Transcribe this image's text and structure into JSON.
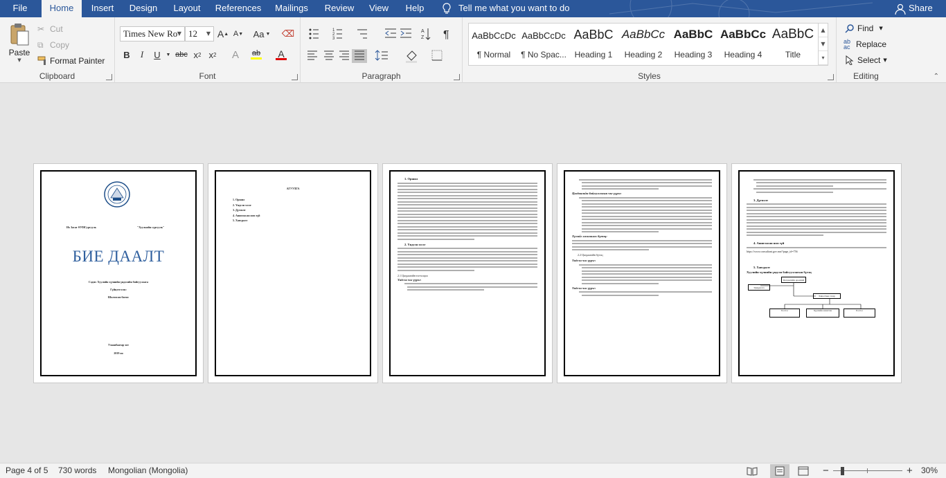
{
  "tabs": [
    {
      "label": "File",
      "active": false
    },
    {
      "label": "Home",
      "active": true
    },
    {
      "label": "Insert",
      "active": false
    },
    {
      "label": "Design",
      "active": false
    },
    {
      "label": "Layout",
      "active": false
    },
    {
      "label": "References",
      "active": false
    },
    {
      "label": "Mailings",
      "active": false
    },
    {
      "label": "Review",
      "active": false
    },
    {
      "label": "View",
      "active": false
    },
    {
      "label": "Help",
      "active": false
    }
  ],
  "tell_me": "Tell me what you want to do",
  "share": "Share",
  "clipboard": {
    "label": "Clipboard",
    "paste": "Paste",
    "cut": "Cut",
    "copy": "Copy",
    "format_painter": "Format Painter"
  },
  "font": {
    "label": "Font",
    "family": "Times New Ro",
    "size": "12",
    "grow": "A",
    "shrink": "A",
    "change_case": "Aa",
    "bold": "B",
    "italic": "I",
    "underline": "U",
    "strike": "abc",
    "subscript": "x",
    "subscript_mark": "2",
    "superscript": "x",
    "superscript_mark": "2",
    "text_effects": "A",
    "highlight": "ab",
    "font_color": "A"
  },
  "paragraph": {
    "label": "Paragraph"
  },
  "styles": {
    "label": "Styles",
    "items": [
      {
        "preview": "AaBbCcDc",
        "name": "¶ Normal"
      },
      {
        "preview": "AaBbCcDc",
        "name": "¶ No Spac..."
      },
      {
        "preview": "AaBbC",
        "name": "Heading 1"
      },
      {
        "preview": "AaBbCc",
        "name": "Heading 2"
      },
      {
        "preview": "AaBbC",
        "name": "Heading 3"
      },
      {
        "preview": "AaBbCc",
        "name": "Heading 4"
      },
      {
        "preview": "AaBbC",
        "name": "Title"
      }
    ]
  },
  "editing": {
    "label": "Editing",
    "find": "Find",
    "replace": "Replace",
    "select": "Select"
  },
  "pages": {
    "p1": {
      "left_text": "Их Засаг ӨУИСургууль",
      "right_text": "\"Хуульийн сургууль\"",
      "title": "БИЕ ДААЛТ",
      "subject": "Сэдэв: Хуулийн хүчнийн үндэсийн байгууллага",
      "checked_by": "Гүйцэтгэсэн:",
      "prof": "Шалгасан багш:",
      "city": "Улаанбаатар хот",
      "year": "2019 он"
    },
    "p2": {
      "heading": "АГУУЛГА",
      "toc": [
        "Оршил",
        "Үндсэн хэсэг",
        "Дүгнэлт",
        "Ашигласан ном зүй",
        "Хавсралт"
      ]
    },
    "p3": {
      "h1": "1.  Оршил",
      "h2": "2.  Үндсэн хэсэг",
      "sub": "2.1 Цагдаагийн тогтолцоо",
      "task": "Үндсэн чиг үүрэг:"
    },
    "p4": {
      "h1": "Цагдаагийн байгууллагын чиг үүрэг:",
      "h2": "Хүчийг хамгаалах бүтэц:",
      "sub": "2.2 Цагдаагийн бүтэц",
      "task": "Үндсэн чиг үүрэг:"
    },
    "p5": {
      "h1": "3.  Дүгнэлт",
      "h2": "4.  Ашигласан ном зүй",
      "ref": "https://www.consultant.gov.mn/?page_id=756",
      "h3": "5.  Хавсралт",
      "chart_title": "Хуулийн хүчнийн үндсэн байгууллагын бүтэц",
      "box1": "Цагдаагийн ерөнхий газар",
      "box2": "Удирдлага",
      "box3": "Хяналтын газар",
      "box4": "Хэлтэс",
      "box5": "Хуулийн ажилтан",
      "box6": "Хэлтэс"
    }
  },
  "status": {
    "page": "Page 4 of 5",
    "words": "730 words",
    "language": "Mongolian (Mongolia)",
    "zoom": "30%",
    "zoom_minus": "−",
    "zoom_plus": "+"
  }
}
